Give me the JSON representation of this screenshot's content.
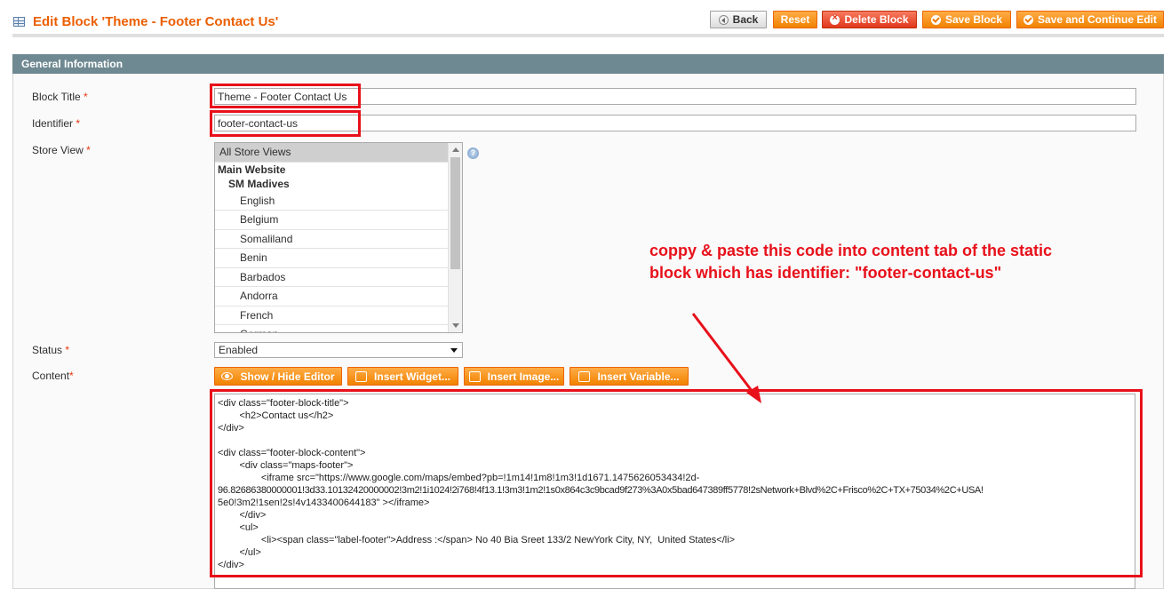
{
  "header": {
    "title": "Edit Block 'Theme - Footer Contact Us'",
    "buttons": {
      "back": "Back",
      "reset": "Reset",
      "delete": "Delete Block",
      "save": "Save Block",
      "save_continue": "Save and Continue Edit"
    }
  },
  "section": {
    "title": "General Information"
  },
  "form": {
    "block_title": {
      "label": "Block Title",
      "value": "Theme - Footer Contact Us"
    },
    "identifier": {
      "label": "Identifier",
      "value": "footer-contact-us"
    },
    "store_view": {
      "label": "Store View",
      "options": [
        "All Store Views",
        "Main Website",
        "SM Madives",
        "English",
        "Belgium",
        "Somaliland",
        "Benin",
        "Barbados",
        "Andorra",
        "French",
        "German"
      ]
    },
    "status": {
      "label": "Status",
      "value": "Enabled"
    },
    "content": {
      "label": "Content",
      "toolbar": {
        "show_hide": "Show / Hide Editor",
        "insert_widget": "Insert Widget...",
        "insert_image": "Insert Image...",
        "insert_variable": "Insert Variable..."
      },
      "lines": [
        "<div class=\"footer-block-title\">",
        "        <h2>Contact us</h2>",
        "</div>",
        "",
        "<div class=\"footer-block-content\">",
        "        <div class=\"maps-footer\">",
        "                <iframe src=\"https://www.google.com/maps/embed?pb=!1m14!1m8!1m3!1d1671.1475626053434!2d-",
        "96.82686380000001!3d33.10132420000002!3m2!1i1024!2i768!4f13.1!3m3!1m2!1s0x864c3c9bcad9f273%3A0x5bad647389ff5778!2sNetwork+Blvd%2C+Frisco%2C+TX+75034%2C+USA!",
        "5e0!3m2!1sen!2s!4v1433400644183\" ></iframe>",
        "        </div>",
        "        <ul>",
        "                <li><span class=\"label-footer\">Address :</span> No 40 Bia Sreet 133/2 NewYork City, NY,  United States</li>",
        "        </ul>",
        "</div>"
      ]
    }
  },
  "annotation": {
    "line1": "coppy  & paste this code into content tab of the static",
    "line2": "block which has identifier: \"footer-contact-us\""
  },
  "colors": {
    "accent": "#eb5e00",
    "section": "#6f8992",
    "highlight": "#e8101a"
  }
}
